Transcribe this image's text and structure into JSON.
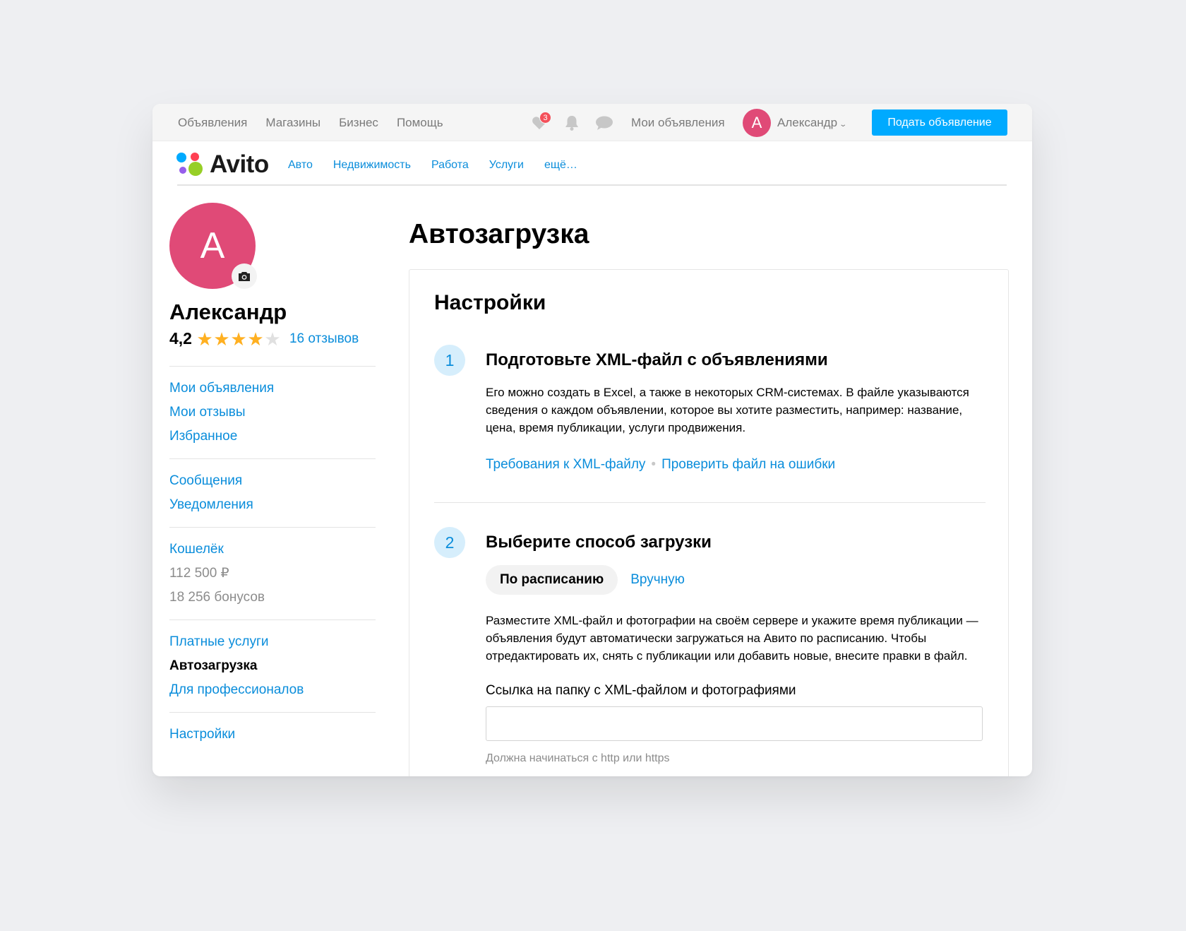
{
  "topbar": {
    "nav": [
      "Объявления",
      "Магазины",
      "Бизнес",
      "Помощь"
    ],
    "favorites_count": "3",
    "my_ads": "Мои объявления",
    "user_initial": "А",
    "user_name": "Александр",
    "post_button": "Подать объявление"
  },
  "logo": {
    "text": "Avito",
    "colors": [
      "#00aaff",
      "#ff4053",
      "#965eeb",
      "#97cf26"
    ]
  },
  "categories": [
    "Авто",
    "Недвижимость",
    "Работа",
    "Услуги",
    "ещё…"
  ],
  "profile": {
    "initial": "А",
    "name": "Александр",
    "rating": "4,2",
    "rating_value": 4.2,
    "stars_filled": 4,
    "stars_total": 5,
    "reviews": "16 отзывов"
  },
  "sidebar": {
    "groups": [
      [
        {
          "label": "Мои объявления",
          "kind": "link"
        },
        {
          "label": "Мои отзывы",
          "kind": "link"
        },
        {
          "label": "Избранное",
          "kind": "link"
        }
      ],
      [
        {
          "label": "Сообщения",
          "kind": "link"
        },
        {
          "label": "Уведомления",
          "kind": "link"
        }
      ],
      [
        {
          "label": "Кошелёк",
          "kind": "link"
        },
        {
          "label": "112 500 ₽",
          "kind": "muted"
        },
        {
          "label": "18 256 бонусов",
          "kind": "muted"
        }
      ],
      [
        {
          "label": "Платные услуги",
          "kind": "link"
        },
        {
          "label": "Автозагрузка",
          "kind": "active"
        },
        {
          "label": "Для профессионалов",
          "kind": "link"
        }
      ],
      [
        {
          "label": "Настройки",
          "kind": "link"
        }
      ]
    ]
  },
  "main": {
    "title": "Автозагрузка",
    "card_title": "Настройки",
    "step1": {
      "number": "1",
      "title": "Подготовьте XML-файл с объявлениями",
      "desc": "Его можно создать в Excel, а также в некоторых CRM-системах. В файле указываются сведения о каждом объявлении, которое вы хотите разместить, например: название, цена, время публикации, услуги продвижения.",
      "link1": "Требования к XML-файлу",
      "link2": "Проверить файл на ошибки"
    },
    "step2": {
      "number": "2",
      "title": "Выберите способ загрузки",
      "tab_active": "По расписанию",
      "tab_inactive": "Вручную",
      "desc": "Разместите XML-файл и фотографии на своём сервере и укажите время публикации — объявления будут автоматически загружаться на Авито по расписанию. Чтобы отредактировать их, снять с публикации или добавить новые, внесите правки в файл.",
      "field_label": "Ссылка на папку с XML-файлом и фотографиями",
      "field_value": "",
      "field_hint": "Должна начинаться с http или https"
    }
  },
  "colors": {
    "accent": "#00aaff",
    "link": "#0a8ddb",
    "avatar": "#e04a77",
    "star": "#ffb021",
    "star_empty": "#e0e0e0",
    "badge": "#f4505a"
  }
}
